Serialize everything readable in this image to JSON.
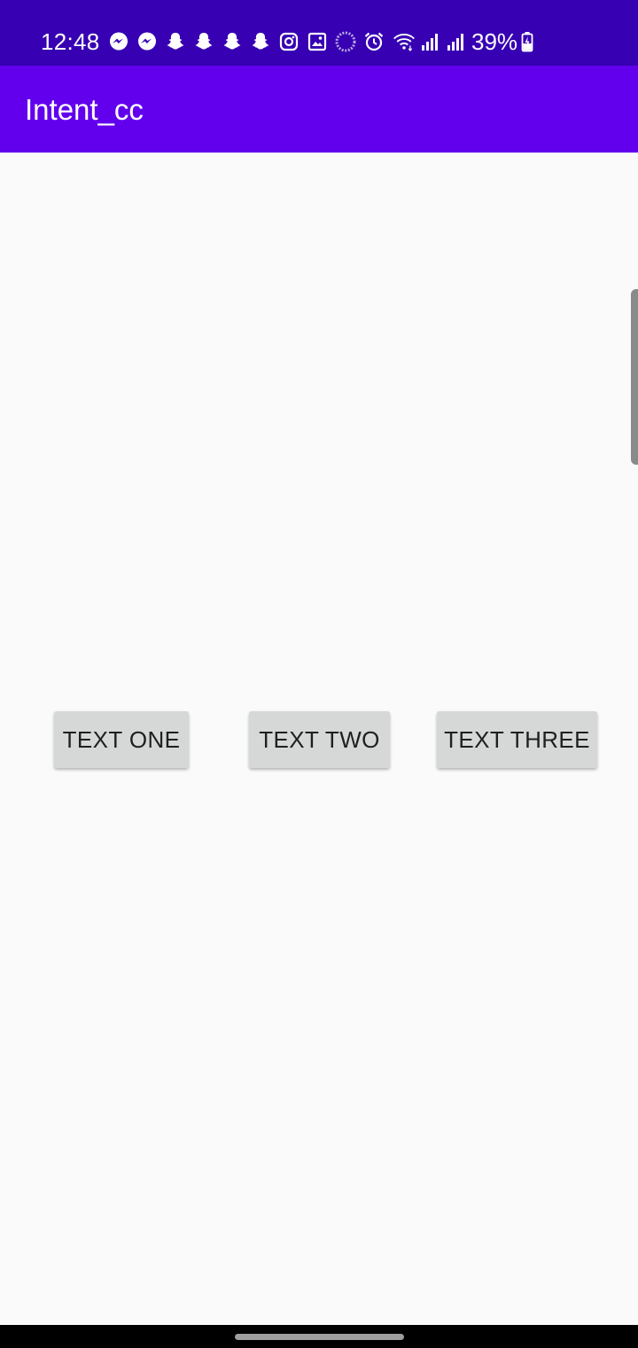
{
  "status_bar": {
    "time": "12:48",
    "battery": "39%",
    "icons": [
      "messenger-icon",
      "messenger-icon",
      "snapchat-icon",
      "snapchat-icon",
      "snapchat-icon",
      "snapchat-icon",
      "instagram-icon",
      "gallery-icon",
      "sync-ring-icon",
      "alarm-icon",
      "wifi-icon",
      "signal-icon",
      "signal-icon",
      "battery-charging-icon"
    ]
  },
  "app_bar": {
    "title": "Intent_cc"
  },
  "buttons": {
    "one": "TEXT ONE",
    "two": "TEXT TWO",
    "three": "TEXT THREE"
  },
  "colors": {
    "status_bar": "#3700b3",
    "app_bar": "#6200ee",
    "background": "#fafafa",
    "button": "#d6d7d7",
    "button_text": "#1f1f1f"
  }
}
